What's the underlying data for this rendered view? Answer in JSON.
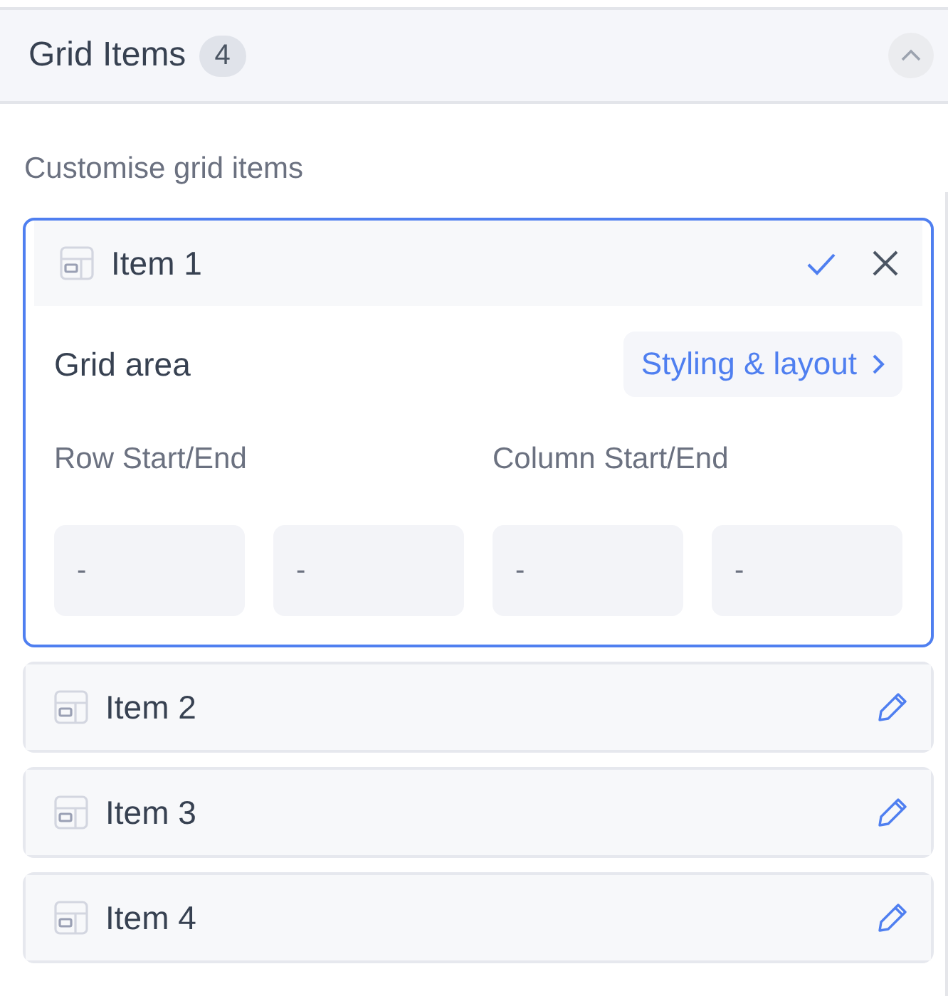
{
  "section": {
    "title": "Grid Items",
    "count": "4",
    "expanded": true
  },
  "subtitle": "Customise grid items",
  "items": [
    {
      "label": "Item 1",
      "expanded": true,
      "heading": "Grid area",
      "link": "Styling & layout",
      "groups": [
        {
          "label": "Row Start/End",
          "fields": [
            {
              "placeholder": "-"
            },
            {
              "placeholder": "-"
            }
          ]
        },
        {
          "label": "Column Start/End",
          "fields": [
            {
              "placeholder": "-"
            },
            {
              "placeholder": "-"
            }
          ]
        }
      ]
    },
    {
      "label": "Item 2",
      "expanded": false
    },
    {
      "label": "Item 3",
      "expanded": false
    },
    {
      "label": "Item 4",
      "expanded": false
    }
  ]
}
